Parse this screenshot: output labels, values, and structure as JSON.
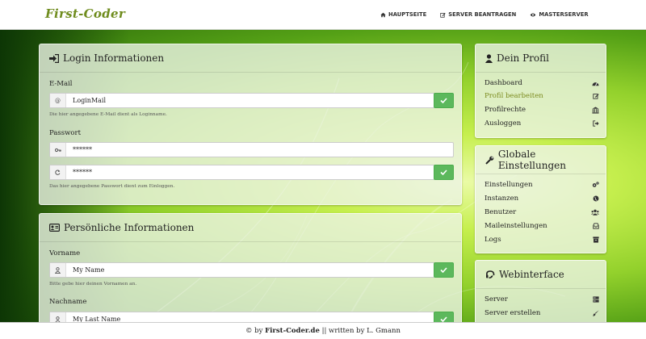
{
  "brand": "First-Coder",
  "nav": [
    "HAUPTSEITE",
    "SERVER BEANTRAGEN",
    "MASTERSERVER"
  ],
  "login": {
    "title": "Login Informationen",
    "email_label": "E-Mail",
    "email_value": "LoginMail",
    "email_help": "Die hier angegebene E-Mail dient als Loginname.",
    "password_label": "Passwort",
    "password_value": "******",
    "password_repeat_value": "******",
    "password_help": "Das hier angegebene Passwort dient zum Einloggen."
  },
  "personal": {
    "title": "Persönliche Informationen",
    "firstname_label": "Vorname",
    "firstname_value": "My Name",
    "firstname_help": "Bitte gebe hier deinen Vornamen an.",
    "lastname_label": "Nachname",
    "lastname_value": "My Last Name"
  },
  "profile": {
    "title": "Dein Profil",
    "items": [
      "Dashboard",
      "Profil bearbeiten",
      "Profilrechte",
      "Ausloggen"
    ]
  },
  "global": {
    "title": "Globale Einstellungen",
    "items": [
      "Einstellungen",
      "Instanzen",
      "Benutzer",
      "Maileinstellungen",
      "Logs"
    ]
  },
  "webinterface": {
    "title": "Webinterface",
    "items": [
      "Server",
      "Server erstellen"
    ]
  },
  "footer": {
    "prefix": "© by",
    "site": "First-Coder.de",
    "middle": "|| written by",
    "author": "L. Gmann"
  },
  "colors": {
    "brand": "#6f8c1e",
    "success": "#5cb85c",
    "active_link": "#7b8a1e"
  }
}
